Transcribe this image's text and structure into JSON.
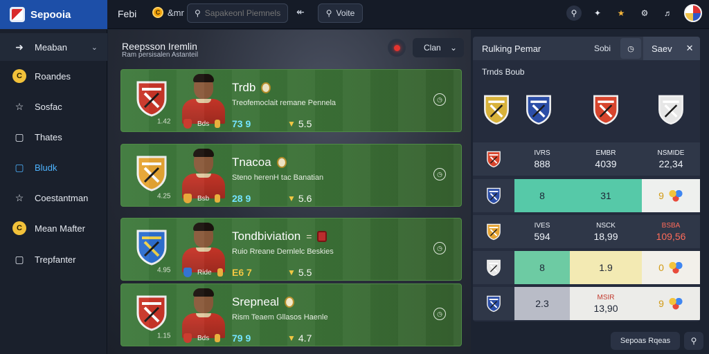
{
  "app": {
    "brand": "Sepooia"
  },
  "topbar": {
    "label": "Febi",
    "coin_text": "&mr",
    "search_placeholder": "Sapakeonl Piemnels",
    "arrow": "↞",
    "voice_label": "Voite",
    "icons": [
      "search-icon",
      "lightning-icon",
      "trophy-icon",
      "gear-icon",
      "bell-icon",
      "avatar"
    ]
  },
  "sidebar": {
    "items": [
      {
        "label": "Meaban",
        "icon": "arrow-icon",
        "chevron": "⌄"
      },
      {
        "label": "Roandes",
        "icon": "coin-icon"
      },
      {
        "label": "Sosfac",
        "icon": "star-icon"
      },
      {
        "label": "Thates",
        "icon": "square-icon"
      },
      {
        "label": "Bludk",
        "icon": "square-icon"
      },
      {
        "label": "Coestantman",
        "icon": "star-icon"
      },
      {
        "label": "Mean Mafter",
        "icon": "coin-icon"
      },
      {
        "label": "Trepfanter",
        "icon": "square-icon"
      }
    ]
  },
  "main": {
    "header_title": "Reepsson Iremlin",
    "header_subtitle": "Ram persisalen Astanteil",
    "filter_label": "Clan",
    "cards": [
      {
        "name": "Trdb",
        "subtitle": "Treofemoclait remane Pennela",
        "number": "1.42",
        "mini_label": "Bds",
        "rating": "73 9",
        "alt_stat": "5.5",
        "crest_color": "#c93628",
        "kit": "red",
        "rating_style": "blue",
        "badge": "gold"
      },
      {
        "name": "Tnacoa",
        "subtitle": "Steno herenH tac Banatian",
        "number": "4.25",
        "mini_label": "Bsb",
        "rating": "28 9",
        "alt_stat": "5.6",
        "crest_color": "#e6a534",
        "kit": "red",
        "rating_style": "blue",
        "badge": "gold"
      },
      {
        "name": "Tondbiviation",
        "subtitle": "Ruio Rreane Dernlelc Beskies",
        "number": "4.95",
        "mini_label": "Ride",
        "rating": "E6 7",
        "alt_stat": "5.5",
        "crest_color": "#2d6fd0",
        "kit": "red",
        "rating_style": "gold",
        "badge": "red",
        "extra": "="
      },
      {
        "name": "Srepneal",
        "subtitle": "Rism Teaem Gllasos Haenle",
        "number": "1.15",
        "mini_label": "Bds",
        "rating": "79 9",
        "alt_stat": "4.7",
        "crest_color": "#c93628",
        "kit": "red",
        "rating_style": "blue",
        "badge": "dark"
      }
    ]
  },
  "rpanel": {
    "title": "Rulking Pemar",
    "sort_label": "Sobi",
    "save_label": "Saev",
    "subtitle": "Trnds Boub",
    "crest_colors": [
      "#d8b23a",
      "#2c4ea7",
      "#d7452d",
      "#e6e6e6"
    ],
    "rows": [
      {
        "bg": "#2f3748",
        "cells": [
          {
            "type": "crest",
            "color": "#d7452d"
          },
          {
            "label": "IVRS",
            "value": "888"
          },
          {
            "label": "EMBR",
            "value": "4039"
          },
          {
            "label": "NSMIDE",
            "value": "22,34"
          }
        ]
      },
      {
        "bg": "mixed1",
        "cells": [
          {
            "type": "crest",
            "color": "#2c4ea7"
          },
          {
            "label": "",
            "value": "8"
          },
          {
            "label": "",
            "value": "31"
          },
          {
            "type": "ball",
            "value": "9"
          }
        ]
      },
      {
        "bg": "#2f3748",
        "cells": [
          {
            "type": "crest",
            "color": "#e6a534"
          },
          {
            "label": "IVES",
            "value": "594"
          },
          {
            "label": "NSCK",
            "value": "18,99"
          },
          {
            "label": "BSBA",
            "value": "109,56"
          }
        ]
      },
      {
        "bg": "mixed2",
        "cells": [
          {
            "type": "crest",
            "color": "#e6e6e6"
          },
          {
            "label": "",
            "value": "8"
          },
          {
            "label": "",
            "value": "1.9"
          },
          {
            "type": "ball",
            "value": "0"
          }
        ]
      },
      {
        "bg": "mixed3",
        "cells": [
          {
            "type": "crest",
            "color": "#2c4ea7"
          },
          {
            "label": "",
            "value": "2.3"
          },
          {
            "label": "MSIR",
            "value": "13,90"
          },
          {
            "type": "ball",
            "value": "9"
          }
        ]
      }
    ]
  },
  "footer": {
    "pager_label": "Sepoas Rqeas",
    "help_icon": "help-icon"
  }
}
